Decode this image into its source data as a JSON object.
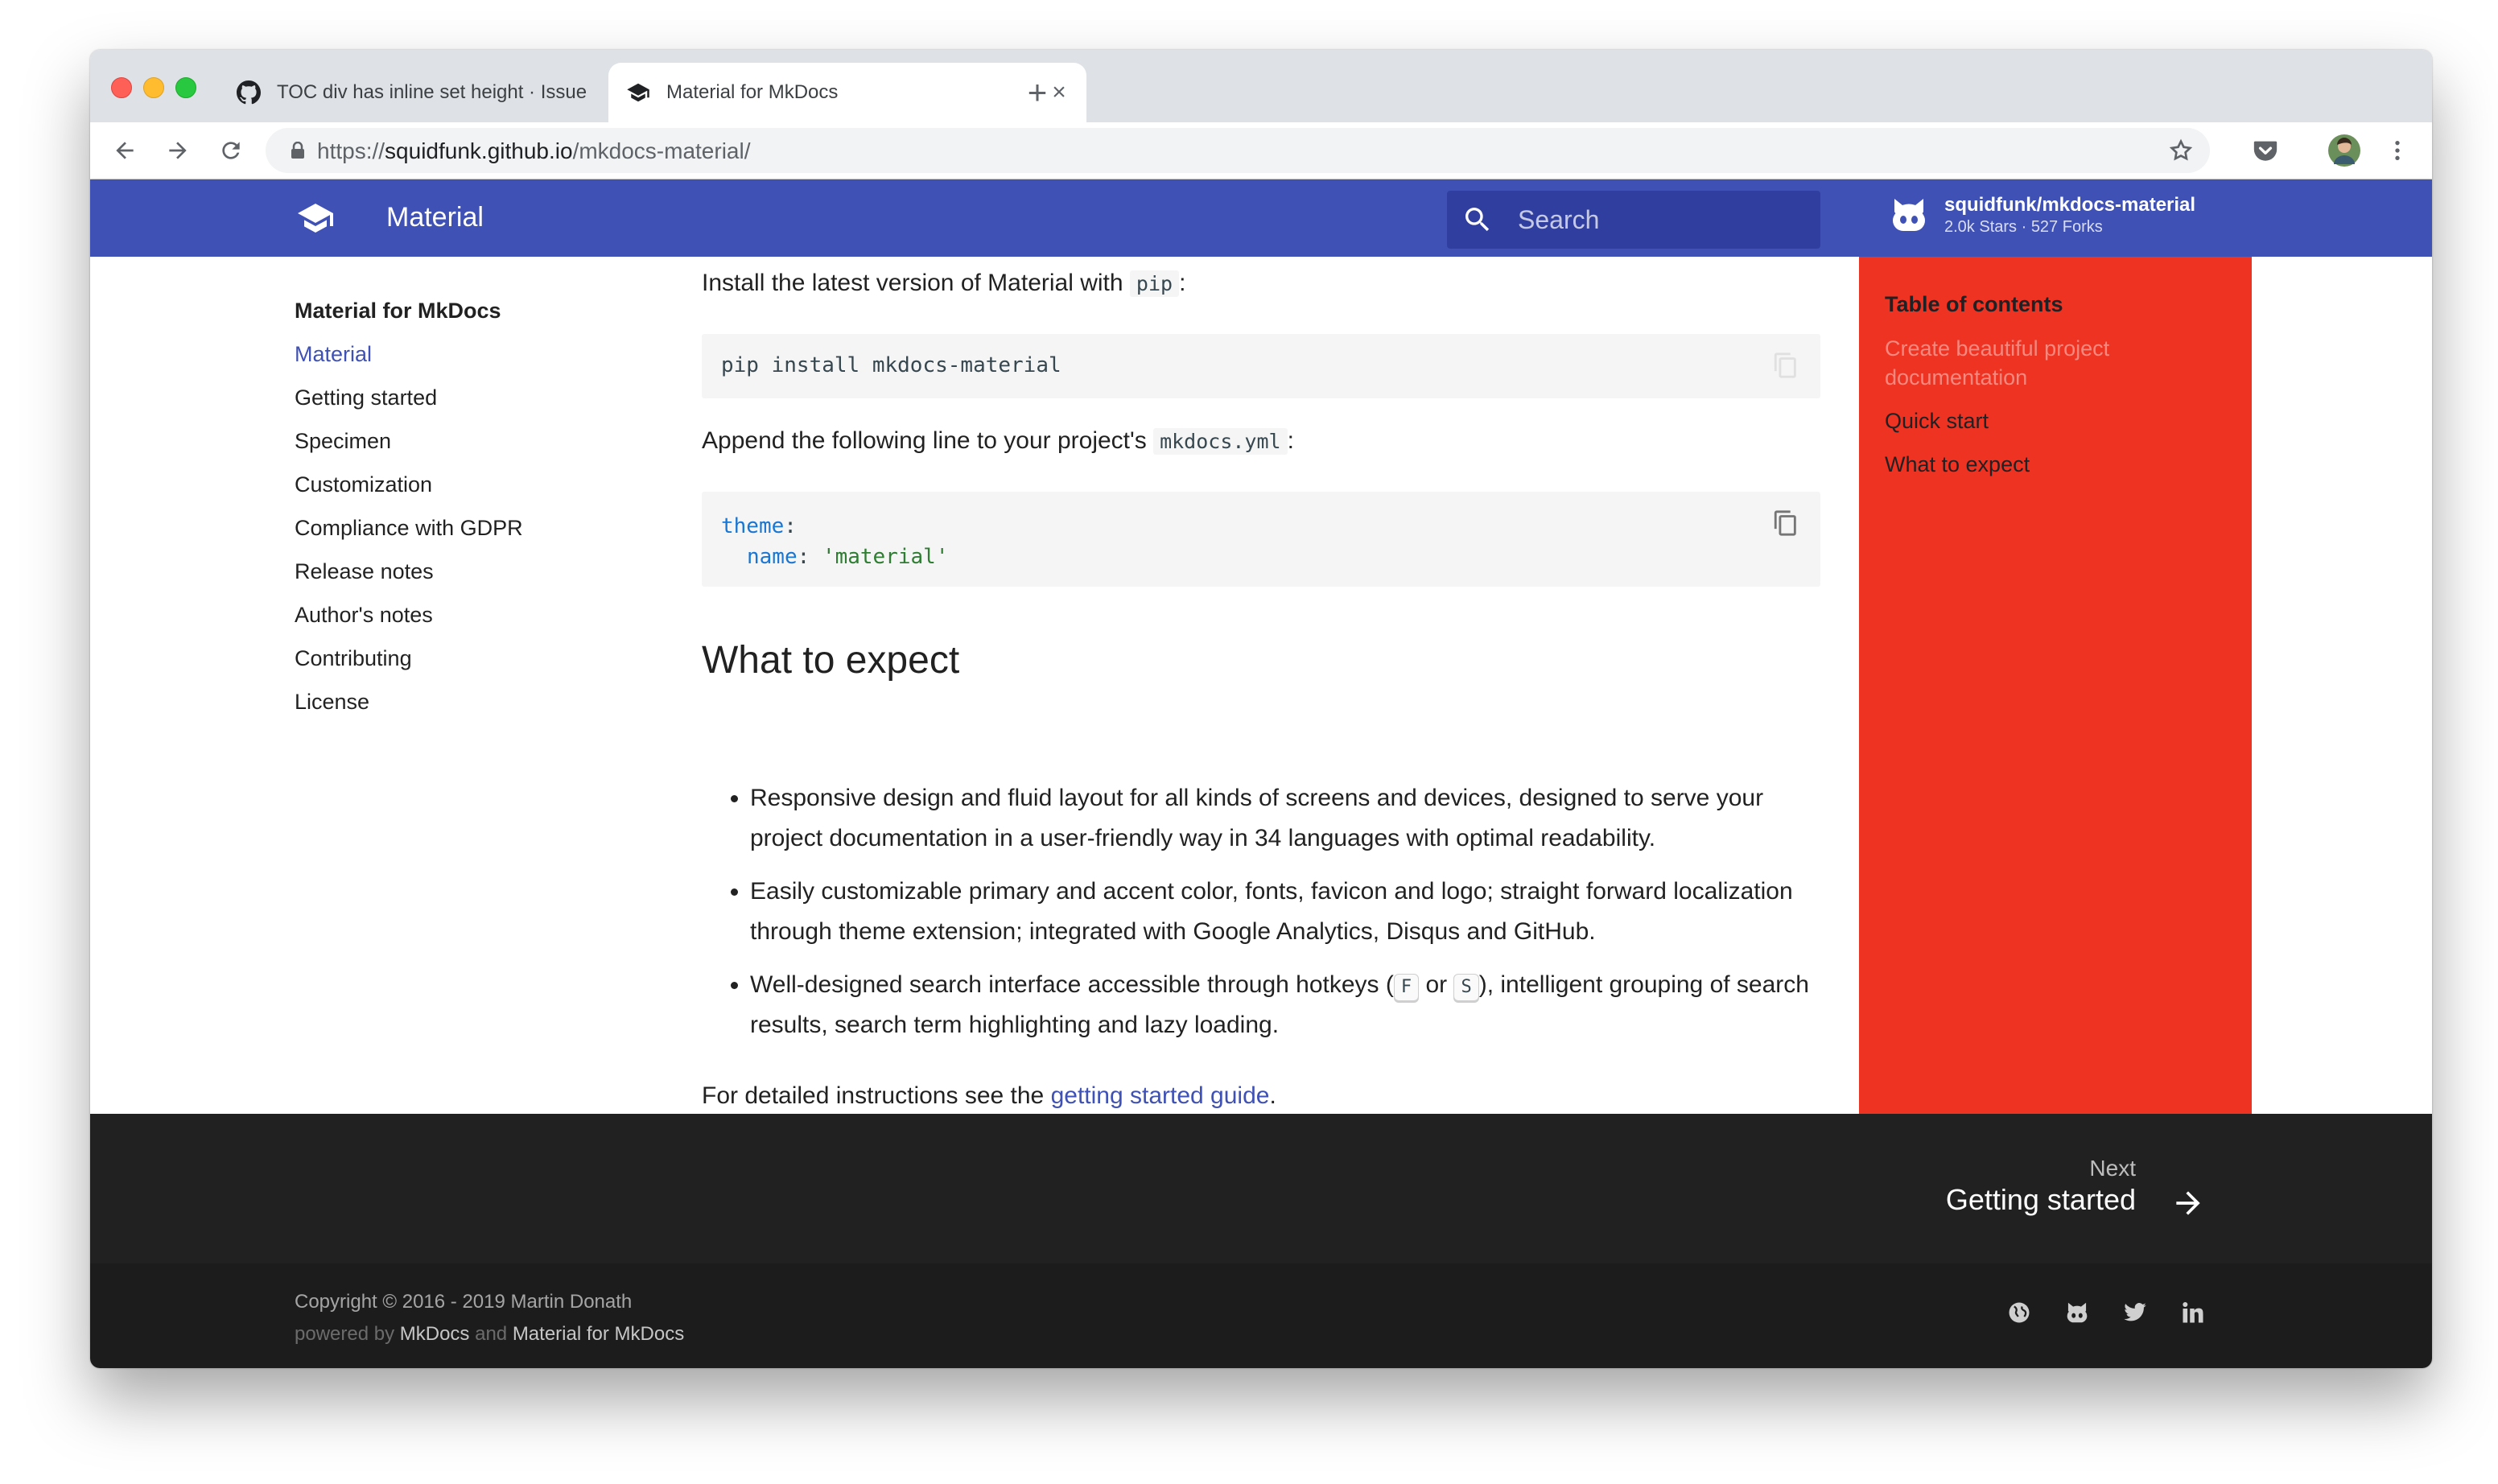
{
  "browser": {
    "tabs": [
      {
        "title": "TOC div has inline set height · Issue",
        "icon": "github-icon",
        "active": false
      },
      {
        "title": "Material for MkDocs",
        "icon": "graduation-cap-icon",
        "active": true
      }
    ],
    "url_scheme": "https://",
    "url_host": "squidfunk.github.io",
    "url_path": "/mkdocs-material/"
  },
  "header": {
    "title": "Material",
    "search_placeholder": "Search",
    "repo_name": "squidfunk/mkdocs-material",
    "repo_stats": "2.0k Stars · 527 Forks"
  },
  "nav": {
    "title": "Material for MkDocs",
    "items": [
      {
        "label": "Material",
        "active": true
      },
      {
        "label": "Getting started"
      },
      {
        "label": "Specimen"
      },
      {
        "label": "Customization"
      },
      {
        "label": "Compliance with GDPR"
      },
      {
        "label": "Release notes"
      },
      {
        "label": "Author's notes"
      },
      {
        "label": "Contributing"
      },
      {
        "label": "License"
      }
    ]
  },
  "main": {
    "install_text": "Install the latest version of Material with",
    "install_code": "pip",
    "install_colon": ":",
    "install_cmd": "pip install mkdocs-material",
    "append_text": "Append the following line to your project's",
    "append_code": "mkdocs.yml",
    "append_colon": ":",
    "yaml_key1": "theme",
    "yaml_key2": "name",
    "yaml_value": "'material'",
    "heading": "What to expect",
    "features": [
      "Responsive design and fluid layout for all kinds of screens and devices, designed to serve your project documentation in a user-friendly way in 34 languages with optimal readability.",
      "Easily customizable primary and accent color, fonts, favicon and logo; straight forward localization through theme extension; integrated with Google Analytics, Disqus and GitHub."
    ],
    "feature3_a": "Well-designed search interface accessible through hotkeys (",
    "feature3_key1": "F",
    "feature3_or": " or ",
    "feature3_key2": "S",
    "feature3_b": "), intelligent grouping of search results, search term highlighting and lazy loading.",
    "details_text": "For detailed instructions see the ",
    "details_link": "getting started guide",
    "details_end": "."
  },
  "toc": {
    "title": "Table of contents",
    "items": [
      {
        "label": "Create beautiful project documentation",
        "active": true
      },
      {
        "label": "Quick start"
      },
      {
        "label": "What to expect"
      }
    ]
  },
  "footer": {
    "next_label": "Next",
    "next_title": "Getting started",
    "copyright": "Copyright © 2016 - 2019 Martin Donath",
    "powered_by": "powered by",
    "mkdocs": "MkDocs",
    "and": "and",
    "material": "Material for MkDocs",
    "social": [
      "globe-icon",
      "github-icon",
      "twitter-icon",
      "linkedin-icon"
    ]
  },
  "colors": {
    "primary": "#3f51b5",
    "primary_dark": "#303f9f",
    "toc_background": "#ee3322",
    "footer": "#212121"
  }
}
